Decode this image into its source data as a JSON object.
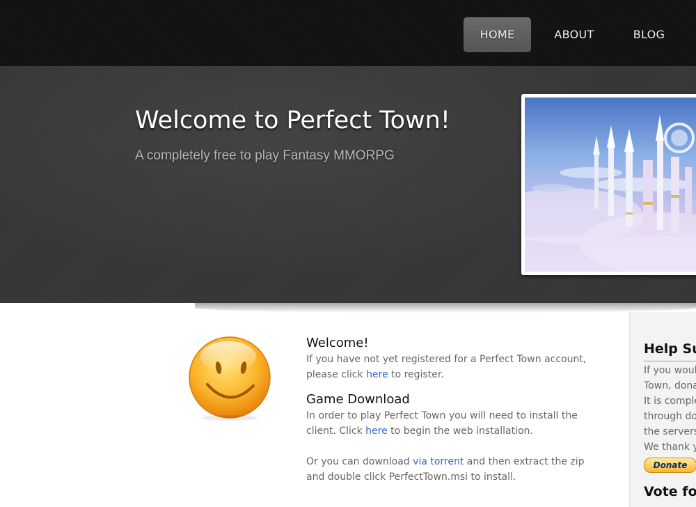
{
  "nav": {
    "items": [
      {
        "label": "HOME",
        "active": true
      },
      {
        "label": "ABOUT",
        "active": false
      },
      {
        "label": "BLOG",
        "active": false
      }
    ]
  },
  "hero": {
    "title": "Welcome to Perfect Town!",
    "subtitle": "A completely free to play Fantasy MMORPG",
    "image_icon": "fantasy-city-image"
  },
  "main": {
    "smiley_icon": "smiley-face-icon",
    "welcome": {
      "title": "Welcome!",
      "text_before": "If you have not yet registered for a Perfect Town account, please click ",
      "link": "here",
      "text_after": " to register."
    },
    "download": {
      "title": "Game Download",
      "p1_before": "In order to play Perfect Town you will need to install the client. Click ",
      "p1_link": "here",
      "p1_after": " to begin the web installation.",
      "p2_before": "Or you can download ",
      "p2_link": "via torrent",
      "p2_after": " and then extract the zip and double click PerfectTown.msi to install."
    },
    "link_color": "#3a66c8"
  },
  "sidebar": {
    "title": "Help Su",
    "lines": [
      "If you woul",
      "Town, dona",
      "It is comple",
      "through dor",
      "the servers",
      "We thank y"
    ],
    "donate_label": "Donate",
    "title2": "Vote fo"
  }
}
